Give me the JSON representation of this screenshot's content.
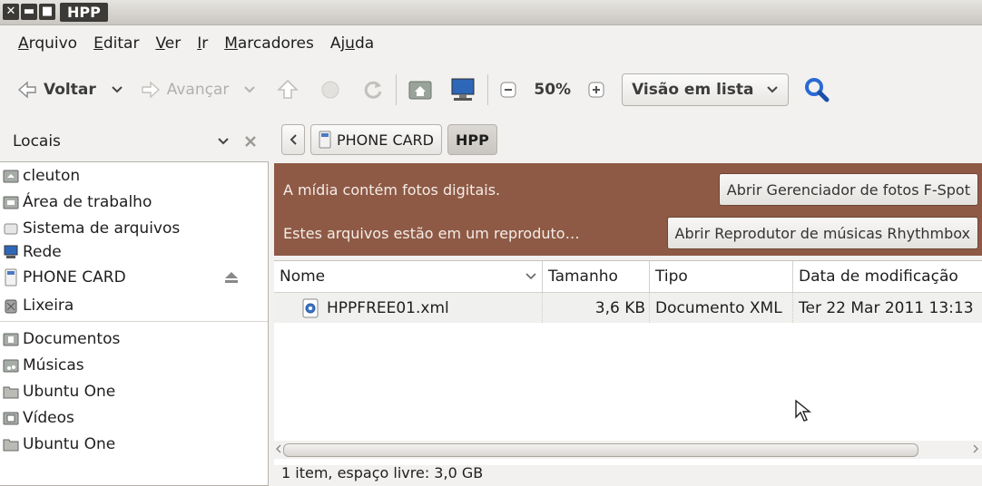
{
  "window": {
    "title": "HPP"
  },
  "menu": [
    {
      "pre": "",
      "u": "A",
      "post": "rquivo"
    },
    {
      "pre": "",
      "u": "E",
      "post": "ditar"
    },
    {
      "pre": "",
      "u": "V",
      "post": "er"
    },
    {
      "pre": "",
      "u": "I",
      "post": "r"
    },
    {
      "pre": "",
      "u": "M",
      "post": "arcadores"
    },
    {
      "pre": "Aj",
      "u": "u",
      "post": "da"
    }
  ],
  "toolbar": {
    "back_label": "Voltar",
    "forward_label": "Avançar",
    "zoom_level": "50%",
    "view_mode": "Visão em lista"
  },
  "sidebar": {
    "header": "Locais",
    "places": [
      {
        "label": "cleuton",
        "icon": "home-folder-icon"
      },
      {
        "label": "Área de trabalho",
        "icon": "desktop-folder-icon"
      },
      {
        "label": "Sistema de arquivos",
        "icon": "drive-icon"
      },
      {
        "label": "Rede",
        "icon": "network-icon"
      },
      {
        "label": "PHONE CARD",
        "icon": "phone-card-icon"
      },
      {
        "label": "Lixeira",
        "icon": "trash-icon"
      }
    ],
    "bookmarks": [
      {
        "label": "Documentos",
        "icon": "documents-folder-icon"
      },
      {
        "label": "Músicas",
        "icon": "music-folder-icon"
      },
      {
        "label": "Ubuntu One",
        "icon": "folder-icon"
      },
      {
        "label": "Vídeos",
        "icon": "videos-folder-icon"
      },
      {
        "label": "Ubuntu One",
        "icon": "folder-icon"
      }
    ]
  },
  "pathbar": {
    "device": "PHONE CARD",
    "current": "HPP"
  },
  "infobar": {
    "photos_text": "A mídia contém fotos digitais.",
    "photos_button": "Abrir Gerenciador de fotos F-Spot",
    "music_text": "Estes arquivos estão em um reproduto…",
    "music_button": "Abrir Reprodutor de músicas Rhythmbox"
  },
  "filelist": {
    "columns": [
      "Nome",
      "Tamanho",
      "Tipo",
      "Data de modificação"
    ],
    "rows": [
      {
        "name": "HPPFREE01.xml",
        "size": "3,6 KB",
        "type": "Documento XML",
        "modified": "Ter 22 Mar 2011 13:13"
      }
    ]
  },
  "status": "1 item, espaço livre: 3,0 GB",
  "colors": {
    "infobar": "#8e5a45",
    "search_icon": "#2a6ad3"
  }
}
